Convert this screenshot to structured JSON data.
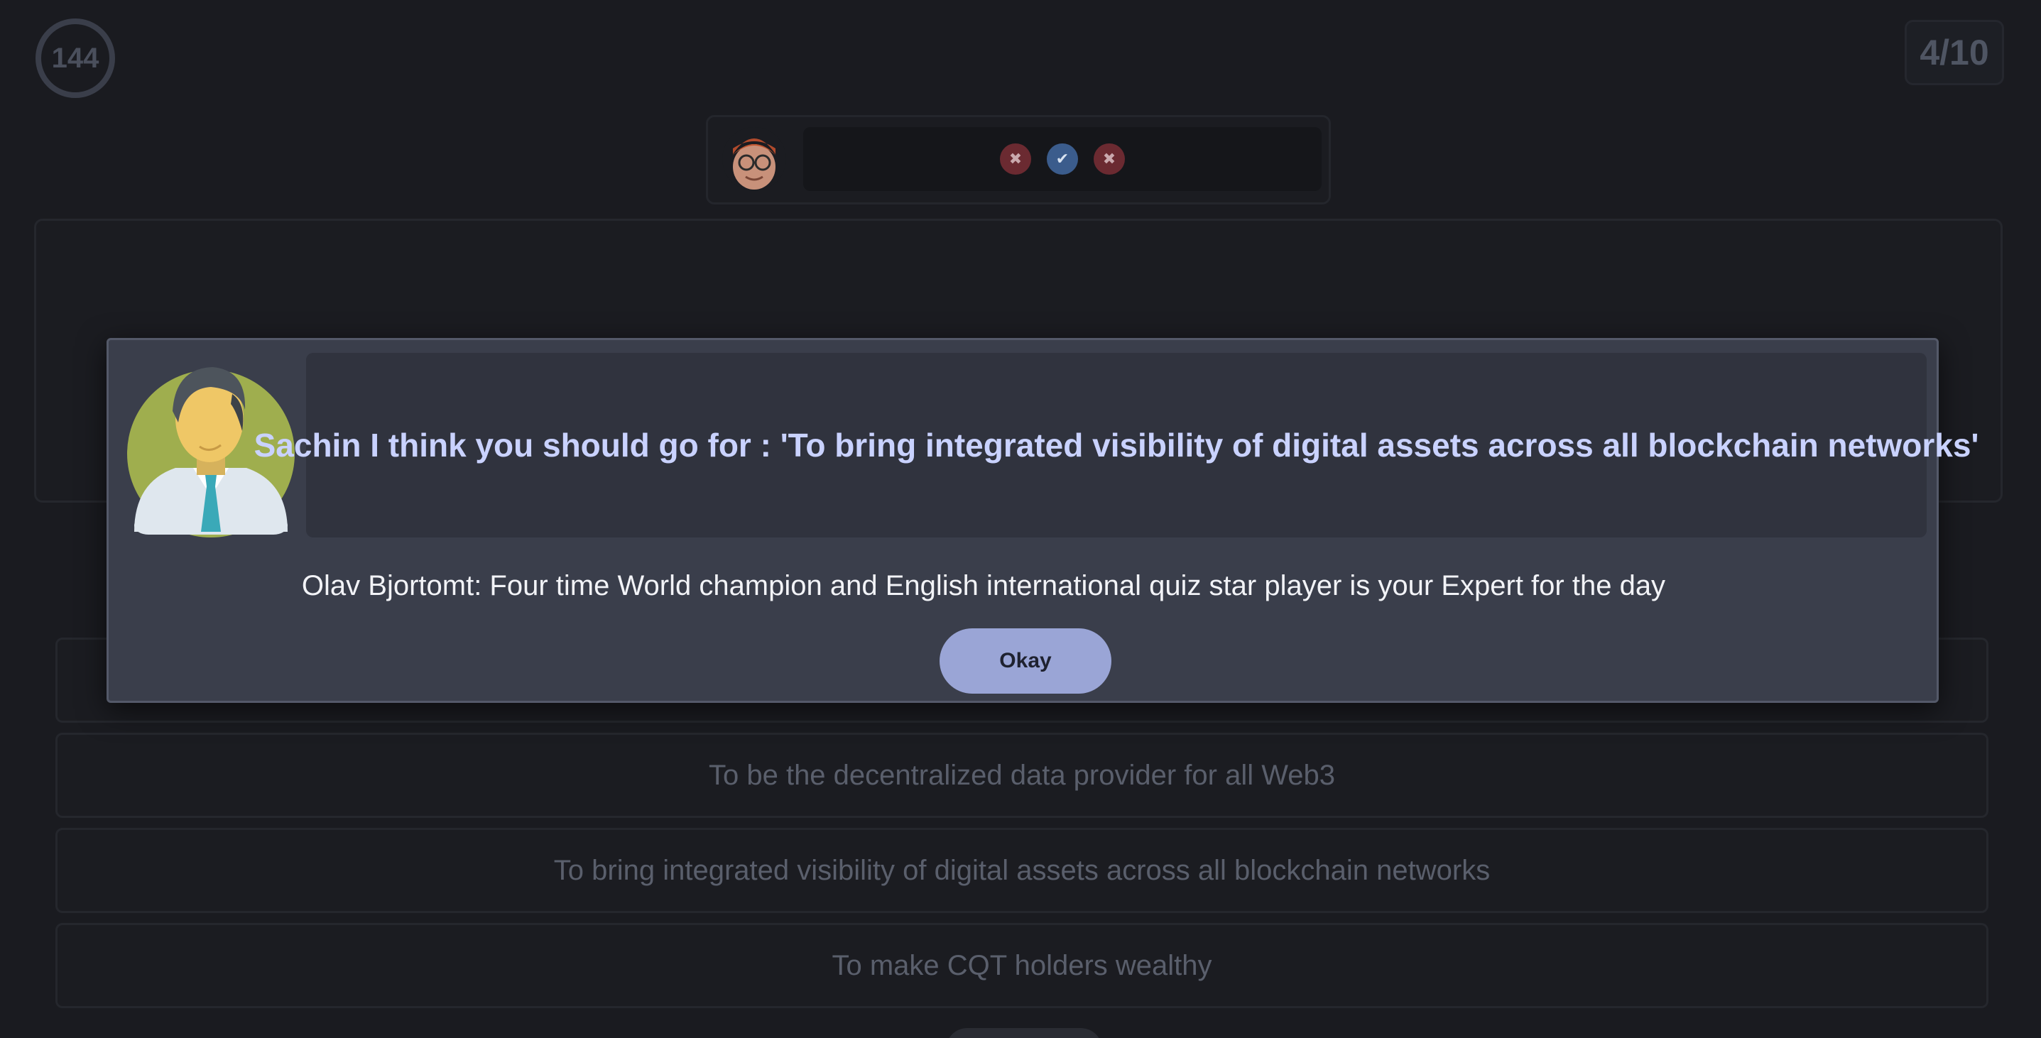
{
  "timer": {
    "value": "144"
  },
  "progress": {
    "label": "4/10"
  },
  "player": {
    "avatar_icon": "memoji-avatar-icon",
    "answers": [
      {
        "status": "wrong",
        "icon": "close-icon",
        "glyph": "✖"
      },
      {
        "status": "right",
        "icon": "check-icon",
        "glyph": "✔"
      },
      {
        "status": "wrong",
        "icon": "close-icon",
        "glyph": "✖"
      }
    ]
  },
  "options": [
    "",
    "To be the decentralized data provider for all Web3",
    "To bring integrated visibility of digital assets across all blockchain networks",
    "To make CQT holders wealthy"
  ],
  "expert_modal": {
    "avatar_icon": "businessman-avatar-icon",
    "message": "Sachin I think you should go for : 'To bring integrated visibility of digital assets across all blockchain networks'",
    "intro": "Olav Bjortomt: Four time World champion and English international quiz star player is your Expert for the day",
    "okay_label": "Okay"
  },
  "colors": {
    "background": "#1a1b20",
    "modal": "#3a3e4b",
    "accent_button": "#9aa5d6",
    "message_text": "#c9d2ff",
    "wrong": "#6b2a31",
    "right": "#3b5c8c"
  }
}
